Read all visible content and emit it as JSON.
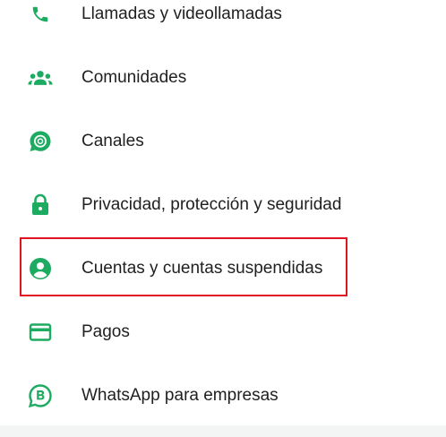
{
  "theme": {
    "accent": "#1daa61",
    "text": "#1f1f1f",
    "highlight_border": "#e0141e"
  },
  "menu": {
    "items": [
      {
        "label": "Llamadas y videollamadas",
        "icon": "phone-icon"
      },
      {
        "label": "Comunidades",
        "icon": "communities-icon"
      },
      {
        "label": "Canales",
        "icon": "channels-icon"
      },
      {
        "label": "Privacidad, protección y seguridad",
        "icon": "lock-icon"
      },
      {
        "label": "Cuentas y cuentas suspendidas",
        "icon": "account-icon",
        "highlighted": true
      },
      {
        "label": "Pagos",
        "icon": "card-icon"
      },
      {
        "label": "WhatsApp para empresas",
        "icon": "business-icon"
      }
    ]
  }
}
